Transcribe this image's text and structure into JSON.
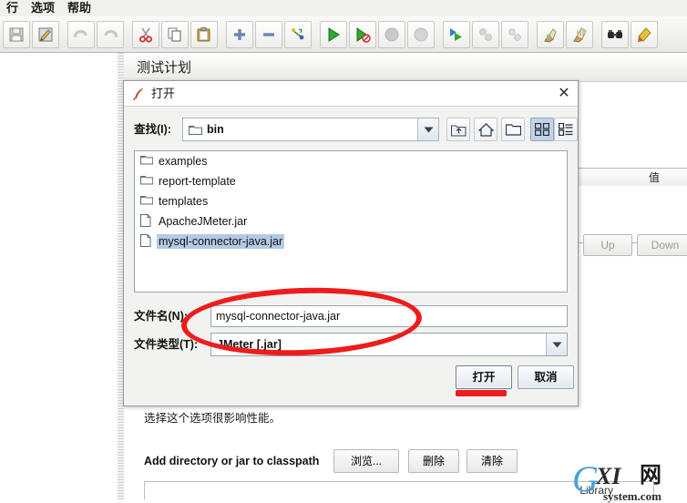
{
  "menubar": {
    "items": [
      {
        "label": "行",
        "name": "menu-run"
      },
      {
        "label": "选项",
        "name": "menu-options"
      },
      {
        "label": "帮助",
        "name": "menu-help"
      }
    ]
  },
  "toolbar": {
    "buttons": [
      {
        "icon": "save-icon",
        "enabled": true
      },
      {
        "icon": "edit-template-icon",
        "enabled": true
      },
      {
        "icon": "undo-icon",
        "enabled": false
      },
      {
        "icon": "redo-icon",
        "enabled": false
      },
      {
        "icon": "cut-icon",
        "enabled": true
      },
      {
        "icon": "copy-icon",
        "enabled": true
      },
      {
        "icon": "paste-icon",
        "enabled": true
      },
      {
        "icon": "expand-icon",
        "enabled": true
      },
      {
        "icon": "collapse-icon",
        "enabled": true
      },
      {
        "icon": "toggle-icon",
        "enabled": true
      },
      {
        "icon": "start-icon",
        "enabled": true
      },
      {
        "icon": "start-no-pauses-icon",
        "enabled": true
      },
      {
        "icon": "stop-icon",
        "enabled": false
      },
      {
        "icon": "shutdown-icon",
        "enabled": false
      },
      {
        "icon": "remote-start-all-icon",
        "enabled": true
      },
      {
        "icon": "remote-stop-all-icon",
        "enabled": false
      },
      {
        "icon": "remote-shutdown-all-icon",
        "enabled": false
      },
      {
        "icon": "clear-icon",
        "enabled": true
      },
      {
        "icon": "clear-all-icon",
        "enabled": true
      },
      {
        "icon": "search-icon",
        "enabled": true
      },
      {
        "icon": "reset-search-icon",
        "enabled": true
      }
    ]
  },
  "app": {
    "panel_title": "测试计划",
    "value_column_header": "值",
    "up_button": "Up",
    "down_button": "Down",
    "hint_text": "选择这个选项很影响性能。",
    "classpath_label": "Add directory or jar to classpath",
    "browse_button": "浏览...",
    "delete_button": "删除",
    "clear_button": "清除",
    "library_column_header": "Library"
  },
  "dialog": {
    "title": "打开",
    "title_icon": "jmeter-feather-icon",
    "close_icon": "close-icon",
    "look_in_label": "查找(I):",
    "look_in_value": "bin",
    "look_in_icon": "folder-icon",
    "nav_buttons": [
      {
        "name": "up-one-level-button",
        "icon": "up-folder-icon",
        "selected": false
      },
      {
        "name": "home-button",
        "icon": "home-icon",
        "selected": false
      },
      {
        "name": "new-folder-button",
        "icon": "new-folder-icon",
        "selected": false
      },
      {
        "name": "grid-view-button",
        "icon": "grid-view-icon",
        "selected": true
      },
      {
        "name": "list-view-button",
        "icon": "list-view-icon",
        "selected": false
      }
    ],
    "files": [
      {
        "name": "examples",
        "type": "folder",
        "selected": false
      },
      {
        "name": "report-template",
        "type": "folder",
        "selected": false
      },
      {
        "name": "templates",
        "type": "folder",
        "selected": false
      },
      {
        "name": "ApacheJMeter.jar",
        "type": "file",
        "selected": false
      },
      {
        "name": "mysql-connector-java.jar",
        "type": "file",
        "selected": true
      }
    ],
    "file_name_label": "文件名(N):",
    "file_name_value": "mysql-connector-java.jar",
    "file_type_label": "文件类型(T):",
    "file_type_value": "JMeter [.jar]",
    "open_button": "打开",
    "cancel_button": "取消"
  },
  "annotations": {
    "ellipse_color": "#ee1c1c",
    "underline_color": "#ee1c1c"
  },
  "watermark": {
    "g": "G",
    "xi": "XI",
    "net": "网",
    "domain": "system.com"
  }
}
